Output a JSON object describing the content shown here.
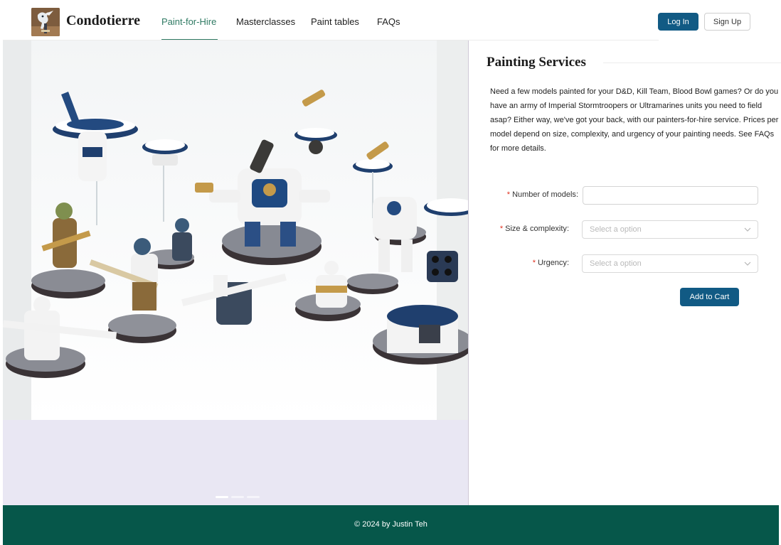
{
  "brand": {
    "name": "Condotierre",
    "logo_icon": "painter-bird-logo"
  },
  "nav": [
    {
      "label": "Paint-for-Hire",
      "active": true
    },
    {
      "label": "Masterclasses",
      "active": false
    },
    {
      "label": "Paint tables",
      "active": false
    },
    {
      "label": "FAQs",
      "active": false
    }
  ],
  "auth": {
    "login_label": "Log In",
    "signup_label": "Sign Up"
  },
  "colors": {
    "accent": "#2f7a63",
    "primary_button": "#115a84",
    "footer_bg": "#06574a",
    "required": "#e0301e"
  },
  "carousel": {
    "slide_count": 3,
    "active_index": 0
  },
  "panel": {
    "title": "Painting Services",
    "description": "Need a few models painted for your D&D, Kill Team, Blood Bowl games? Or do you have an army of Imperial Stormtroopers or Ultramarines units you need to field asap? Either way, we've got your back, with our painters-for-hire service. Prices per model depend on size, complexity, and urgency of your painting needs. See FAQs for more details."
  },
  "form": {
    "required_mark": "*",
    "models": {
      "label": "Number of models",
      "value": ""
    },
    "size": {
      "label": "Size & complexity",
      "placeholder": "Select a option"
    },
    "urgency": {
      "label": "Urgency",
      "placeholder": "Select a option"
    },
    "submit_label": "Add to Cart"
  },
  "footer": {
    "text": "© 2024 by Justin Teh"
  }
}
